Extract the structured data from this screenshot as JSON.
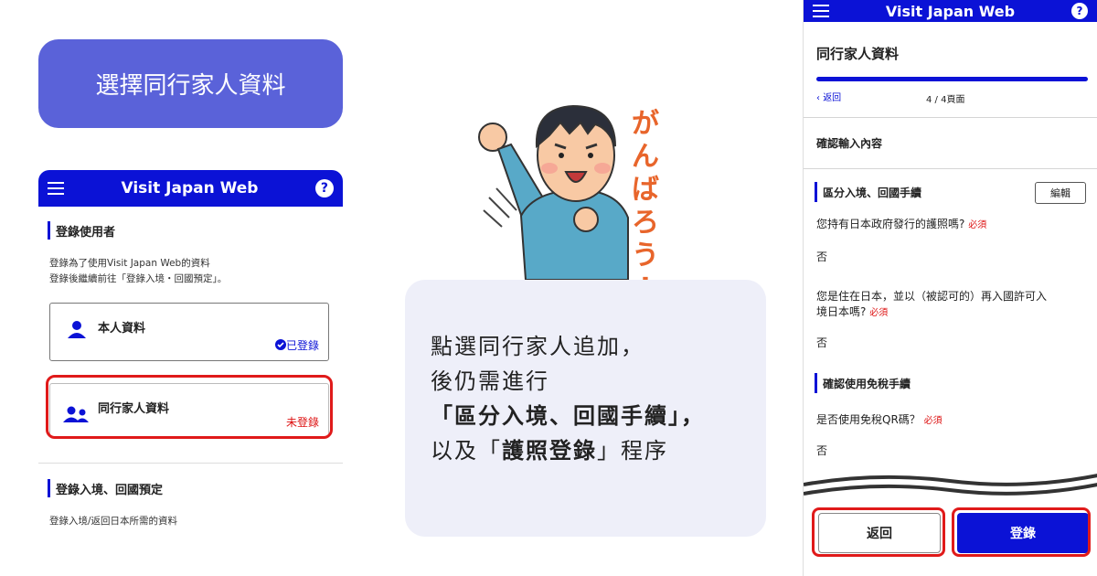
{
  "pill": {
    "label": "選擇同行家人資料"
  },
  "left_phone": {
    "app_title": "Visit Japan Web",
    "help": "?",
    "section1": {
      "title": "登錄使用者",
      "desc_line1": "登錄為了使用Visit Japan Web的資料",
      "desc_line2": "登錄後繼續前往「登錄入境・回國預定」。"
    },
    "card_self": {
      "name": "本人資料",
      "status": "已登錄",
      "status_color": "#0b12d6"
    },
    "card_family": {
      "name": "同行家人資料",
      "status": "未登錄",
      "status_color": "#d11"
    },
    "section2": {
      "title": "登錄入境、回國預定",
      "desc": "登錄入境/返回日本所需的資料"
    }
  },
  "mascot": {
    "shout": [
      "が",
      "ん",
      "ば",
      "ろ",
      "う",
      "!"
    ]
  },
  "bubble": {
    "line1": "點選同行家人追加，",
    "line2": "後仍需進行",
    "line3": "「區分入境、回國手續」，",
    "line4_a": "以及「",
    "line4_b": "護照登錄",
    "line4_c": "」程序"
  },
  "right_phone": {
    "app_title": "Visit Japan Web",
    "help": "?",
    "page_title": "同行家人資料",
    "back_link": "返回",
    "page_counter": "4 / 4頁面",
    "confirm_heading": "確認輸入內容",
    "section_entry": {
      "title": "區分入境、回國手續",
      "edit": "編輯"
    },
    "q1": {
      "text": "您持有日本政府發行的護照嗎?",
      "required": "必須",
      "answer": "否"
    },
    "q2": {
      "text_line1": "您是住在日本，並以（被認可的）再入國許可入",
      "text_line2": "境日本嗎?",
      "required": "必須",
      "answer": "否"
    },
    "section_tax": {
      "title": "確認使用免稅手續"
    },
    "q3": {
      "text": "是否使用免稅QR碼？",
      "required": "必須",
      "answer": "否"
    },
    "btn_back": "返回",
    "btn_register": "登錄"
  },
  "colors": {
    "accent": "#0b12d6",
    "pill": "#5a62d9",
    "alert": "#e01a1a",
    "bubble": "#eeeff9"
  }
}
